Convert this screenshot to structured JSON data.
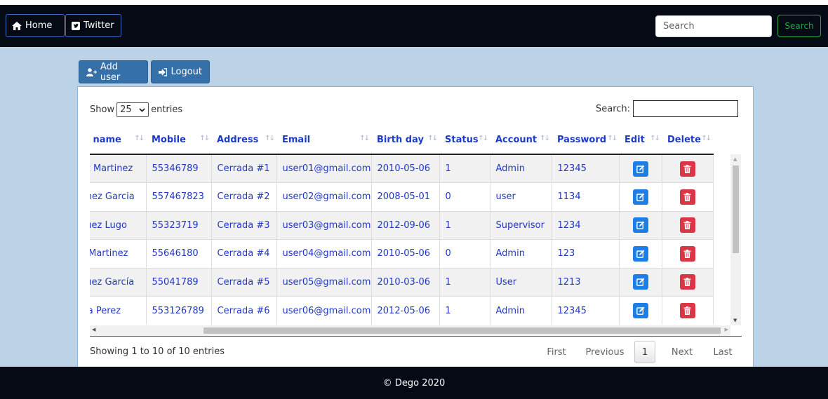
{
  "nav": {
    "home_label": "Home",
    "twitter_label": "Twitter",
    "search_placeholder": "Search",
    "search_button": "Search"
  },
  "actions": {
    "add_user": "Add user",
    "logout": "Logout"
  },
  "table_controls": {
    "show_prefix": "Show",
    "page_size": "25",
    "show_suffix": "entries",
    "search_label": "Search:"
  },
  "table": {
    "headers": [
      "st name",
      "Mobile",
      "Address",
      "Email",
      "Birth day",
      "Status",
      "Account",
      "Password",
      "Edit",
      "Delete"
    ],
    "rows": [
      [
        "ez Martinez",
        "55346789",
        "Cerrada #1",
        "user01@gmail.com",
        "2010-05-06",
        "1",
        "Admin",
        "12345"
      ],
      [
        "tinez Garcia",
        "557467823",
        "Cerrada #2",
        "user02@gmail.com",
        "2008-05-01",
        "0",
        "user",
        "1134"
      ],
      [
        "quez Lugo",
        "55323719",
        "Cerrada #3",
        "user03@gmail.com",
        "2012-09-06",
        "1",
        "Supervisor",
        "1234"
      ],
      [
        "a Martinez",
        "55646180",
        "Cerrada #4",
        "user04@gmail.com",
        "2010-05-06",
        "0",
        "Admin",
        "123"
      ],
      [
        "quez García",
        "55041789",
        "Cerrada #5",
        "user05@gmail.com",
        "2010-03-06",
        "1",
        "User",
        "1213"
      ],
      [
        "cia Perez",
        "553126789",
        "Cerrada #6",
        "user06@gmail.com",
        "2012-05-06",
        "1",
        "Admin",
        "12345"
      ]
    ],
    "edit_icon": "edit-icon",
    "delete_icon": "trash-icon"
  },
  "footer_info": {
    "showing": "Showing 1 to 10 of 10 entries"
  },
  "pagination": {
    "first": "First",
    "previous": "Previous",
    "current": "1",
    "next": "Next",
    "last": "Last"
  },
  "footer": {
    "copyright": "© Dego 2020"
  },
  "colors": {
    "navbar": "#050a14",
    "content_bg": "#bcd3e7",
    "primary_button": "#3670a8",
    "edit": "#1e7ee8",
    "delete": "#dc3545",
    "link_text": "#2238c2",
    "search_button": "#28a745"
  }
}
